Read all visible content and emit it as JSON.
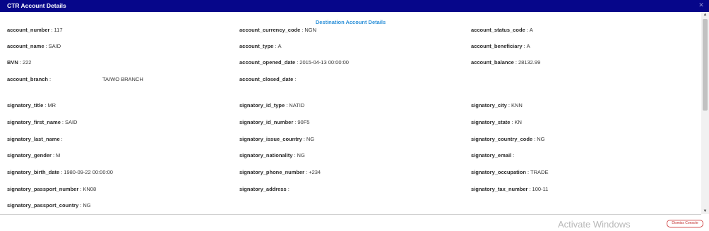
{
  "window": {
    "title": "CTR Account Details",
    "close_icon": "close-icon"
  },
  "section": {
    "title": "Destination Account Details"
  },
  "fields": {
    "account_number": {
      "label": "account_number",
      "value": "117"
    },
    "account_currency_code": {
      "label": "account_currency_code",
      "value": "NGN"
    },
    "account_status_code": {
      "label": "account_status_code",
      "value": "A"
    },
    "account_name": {
      "label": "account_name",
      "value": "SAID"
    },
    "account_type": {
      "label": "account_type",
      "value": "A"
    },
    "account_beneficiary": {
      "label": "account_beneficiary",
      "value": "A"
    },
    "bvn": {
      "label": "BVN",
      "value": "222"
    },
    "account_opened_date": {
      "label": "account_opened_date",
      "value": "2015-04-13 00:00:00"
    },
    "account_balance": {
      "label": "account_balance",
      "value": "28132.99"
    },
    "account_branch": {
      "label": "account_branch",
      "value": "TAIWO BRANCH"
    },
    "account_closed_date": {
      "label": "account_closed_date",
      "value": ""
    },
    "signatory_title": {
      "label": "signatory_title",
      "value": "MR"
    },
    "signatory_id_type": {
      "label": "signatory_id_type",
      "value": "NATID"
    },
    "signatory_city": {
      "label": "signatory_city",
      "value": "KNN"
    },
    "signatory_first_name": {
      "label": "signatory_first_name",
      "value": "SAID"
    },
    "signatory_id_number": {
      "label": "signatory_id_number",
      "value": "90F5"
    },
    "signatory_state": {
      "label": "signatory_state",
      "value": "KN"
    },
    "signatory_last_name": {
      "label": "signatory_last_name",
      "value": ""
    },
    "signatory_issue_country": {
      "label": "signatory_issue_country",
      "value": "NG"
    },
    "signatory_country_code": {
      "label": "signatory_country_code",
      "value": "NG"
    },
    "signatory_gender": {
      "label": "signatory_gender",
      "value": "M"
    },
    "signatory_nationality": {
      "label": "signatory_nationality",
      "value": "NG"
    },
    "signatory_email": {
      "label": "signatory_email",
      "value": ""
    },
    "signatory_birth_date": {
      "label": "signatory_birth_date",
      "value": "1980-09-22 00:00:00"
    },
    "signatory_phone_number": {
      "label": "signatory_phone_number",
      "value": "+234"
    },
    "signatory_occupation": {
      "label": "signatory_occupation",
      "value": "TRADE"
    },
    "signatory_passport_number": {
      "label": "signatory_passport_number",
      "value": "KN08"
    },
    "signatory_address": {
      "label": "signatory_address",
      "value": ""
    },
    "signatory_tax_number": {
      "label": "signatory_tax_number",
      "value": "100-11"
    },
    "signatory_passport_country": {
      "label": "signatory_passport_country",
      "value": "NG"
    }
  },
  "footer": {
    "watermark": "Activate Windows",
    "dismiss_label": "Dismiss Console"
  },
  "colors": {
    "titlebar": "#06068a",
    "section_title": "#2a8fd8",
    "dismiss_border": "#d24a4a"
  }
}
